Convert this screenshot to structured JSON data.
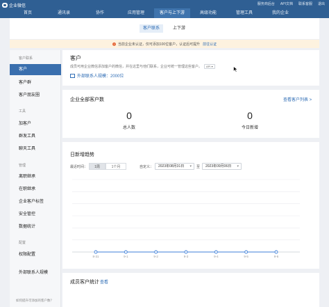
{
  "header": {
    "logo_text": "企业微信",
    "links": [
      "服务商后台",
      "API文档",
      "联系客服",
      "退出"
    ],
    "nav": [
      {
        "label": "首页",
        "active": false
      },
      {
        "label": "通讯录",
        "active": false
      },
      {
        "label": "协作",
        "active": false
      },
      {
        "label": "应用管理",
        "active": false
      },
      {
        "label": "客户与上下游",
        "active": true
      },
      {
        "label": "高级功能",
        "active": false
      },
      {
        "label": "管理工具",
        "active": false
      },
      {
        "label": "我的企业",
        "active": false
      }
    ]
  },
  "subtabs": [
    {
      "label": "客户联系",
      "active": true
    },
    {
      "label": "上下游",
      "active": false
    }
  ],
  "notice": {
    "text": "当前企业未认证，仅可添加100位客户，认证后可提升",
    "link": "前往认证"
  },
  "sidebar": {
    "groups": [
      {
        "label": "客户联系",
        "items": [
          {
            "label": "客户",
            "active": true
          },
          {
            "label": "客户群",
            "active": false
          },
          {
            "label": "客户朋友圈",
            "active": false
          }
        ]
      },
      {
        "label": "工具",
        "items": [
          {
            "label": "加客户",
            "active": false
          },
          {
            "label": "群发工具",
            "active": false
          },
          {
            "label": "聊天工具",
            "active": false
          }
        ]
      },
      {
        "label": "管理",
        "items": [
          {
            "label": "离职继承",
            "active": false
          },
          {
            "label": "在职继承",
            "active": false
          },
          {
            "label": "企业客户标签",
            "active": false
          },
          {
            "label": "安全管控",
            "active": false
          },
          {
            "label": "数据统计",
            "active": false
          }
        ]
      },
      {
        "label": "配置",
        "items": [
          {
            "label": "权限配置",
            "active": false
          },
          {
            "label": "外部联系人规模",
            "active": false
          }
        ]
      }
    ],
    "footer": "如何提升可添加的客户数？"
  },
  "main": {
    "title": "客户",
    "description": "成员可用企业微信添加客户的微信，并在这里与他们联系，企业可统一管理这些客户。",
    "api_badge": "API",
    "quota_text": "外部联系人规模：2000位",
    "all_customers": {
      "title": "企业全部客户数",
      "link": "查看客户列表 >",
      "total_value": "0",
      "total_label": "总人数",
      "today_value": "0",
      "today_label": "今日新增"
    },
    "trend": {
      "title": "日新增趋势",
      "range_label": "最近时间：",
      "range_options": [
        {
          "label": "1周",
          "active": true
        },
        {
          "label": "1个月",
          "active": false
        }
      ],
      "custom_label": "自定义：",
      "date_from": "2023年08月31日",
      "date_sep": "至",
      "date_to": "2023年09月06日"
    },
    "member_stats": {
      "title": "成员客户统计",
      "link": "查看"
    }
  },
  "chart_data": {
    "type": "line",
    "x": [
      "8-31",
      "9-1",
      "9-2",
      "9-3",
      "9-4",
      "9-5",
      "9-6"
    ],
    "series": [
      {
        "values": [
          0,
          0,
          0,
          0,
          0,
          0,
          0
        ]
      }
    ],
    "ylim": [
      0,
      1
    ],
    "grid": true,
    "line_color": "#3d7fd9"
  },
  "colors": {
    "header_bg": "#2f5f93",
    "accent": "#2f6db5",
    "sidebar_active": "#3a6fae"
  }
}
